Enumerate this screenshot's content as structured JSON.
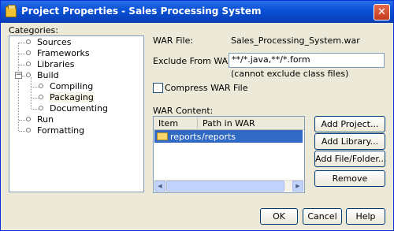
{
  "window": {
    "title": "Project Properties - Sales Processing System",
    "close_glyph": "✕"
  },
  "categories": {
    "label": "Categories:",
    "items": [
      {
        "label": "Sources"
      },
      {
        "label": "Frameworks"
      },
      {
        "label": "Libraries"
      },
      {
        "label": "Build"
      },
      {
        "label": "Compiling"
      },
      {
        "label": "Packaging"
      },
      {
        "label": "Documenting"
      },
      {
        "label": "Run"
      },
      {
        "label": "Formatting"
      }
    ],
    "expander_glyph": "−"
  },
  "war_file": {
    "label": "WAR File:",
    "value": "Sales_Processing_System.war"
  },
  "exclude": {
    "label": "Exclude From WAR File:",
    "value": "**/*.java,**/*.form",
    "hint": "(cannot exclude class files)"
  },
  "compress": {
    "label": "Compress WAR File",
    "checked": false
  },
  "war_content": {
    "label": "WAR Content:",
    "columns": [
      "Item",
      "Path in WAR"
    ],
    "rows": [
      {
        "item": "reports",
        "path": "/reports"
      }
    ]
  },
  "side_buttons": {
    "add_project": "Add Project...",
    "add_library": "Add Library...",
    "add_file": "Add File/Folder...",
    "remove": "Remove"
  },
  "footer": {
    "ok": "OK",
    "cancel": "Cancel",
    "help": "Help"
  },
  "scroll": {
    "left_glyph": "◀",
    "right_glyph": "▶"
  }
}
